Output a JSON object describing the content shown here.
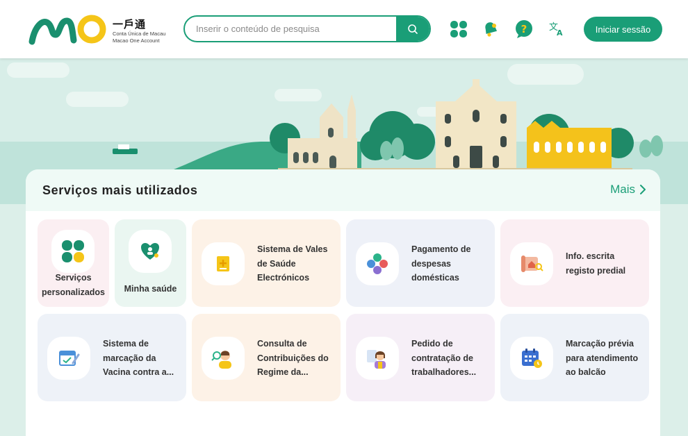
{
  "header": {
    "logo_title": "一戶通",
    "logo_sub1": "Conta Única de Macau",
    "logo_sub2": "Macao One Account",
    "search_placeholder": "Inserir o conteúdo de pesquisa",
    "login_label": "Iniciar sessão",
    "icons": [
      "clover-icon",
      "bell-icon",
      "help-icon",
      "translate-icon"
    ],
    "brand_color": "#1a9e77"
  },
  "services": {
    "title": "Serviços mais utilizados",
    "more_label": "Mais",
    "row1": [
      {
        "label": "Serviços personalizados",
        "icon": "clover-icon"
      },
      {
        "label": "Minha saúde",
        "icon": "health-heart-icon"
      },
      {
        "label": "Sistema de Vales de Saúde Electrónicos",
        "icon": "health-voucher-icon"
      },
      {
        "label": "Pagamento de despesas domésticas",
        "icon": "utilities-icon"
      },
      {
        "label": "Info. escrita registo predial",
        "icon": "property-scroll-icon"
      }
    ],
    "row2": [
      {
        "label": "Sistema de marcação da Vacina contra a...",
        "icon": "vaccine-calendar-icon"
      },
      {
        "label": "Consulta de Contribuições do Regime da...",
        "icon": "contribution-search-icon"
      },
      {
        "label": "Pedido de contratação de trabalhadores...",
        "icon": "worker-hiring-icon"
      },
      {
        "label": "Marcação prévia para atendimento ao balcão",
        "icon": "appointment-calendar-icon"
      }
    ]
  }
}
